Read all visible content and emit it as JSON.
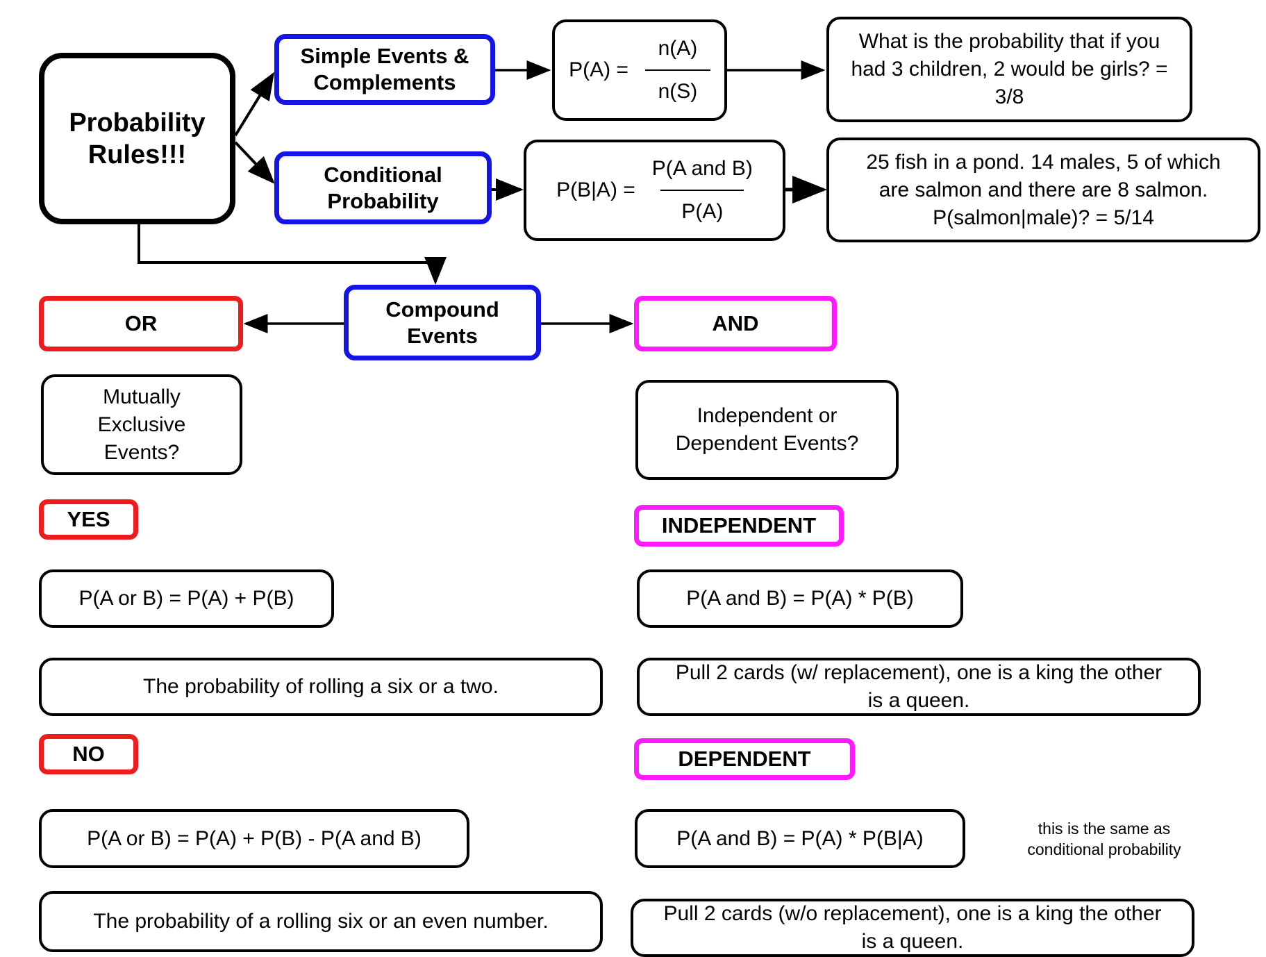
{
  "root": {
    "title_line1": "Probability",
    "title_line2": "Rules!!!"
  },
  "simple_events": {
    "label_line1": "Simple Events &",
    "label_line2": "Complements",
    "formula": {
      "lhs": "P(A) =",
      "numerator": "n(A)",
      "denominator": "n(S)"
    },
    "example": "What is the probability that if you had 3 children, 2 would be girls? = 3/8"
  },
  "conditional": {
    "label_line1": "Conditional",
    "label_line2": "Probability",
    "formula": {
      "lhs": "P(B|A) =",
      "numerator": "P(A and B)",
      "denominator": "P(A)"
    },
    "example": "25 fish in a pond. 14 males, 5 of which are salmon and there are 8 salmon. P(salmon|male)? = 5/14"
  },
  "compound": {
    "label_line1": "Compound",
    "label_line2": "Events",
    "or_branch": {
      "label": "OR",
      "question": "Mutually Exclusive Events?",
      "yes": {
        "label": "YES",
        "formula": "P(A or B) = P(A) + P(B)",
        "example": "The probability of rolling a six or a two."
      },
      "no": {
        "label": "NO",
        "formula": "P(A or B) = P(A) + P(B) - P(A and B)",
        "example": "The probability of a rolling six or an even number."
      }
    },
    "and_branch": {
      "label": "AND",
      "question": "Independent or Dependent Events?",
      "independent": {
        "label": "INDEPENDENT",
        "formula": "P(A and B) = P(A) * P(B)",
        "example": "Pull 2 cards (w/ replacement), one is a king the other is a queen."
      },
      "dependent": {
        "label": "DEPENDENT",
        "formula": "P(A and B) = P(A) * P(B|A)",
        "note": "this is the same as conditional probability",
        "example": "Pull 2 cards (w/o replacement), one is a king the other is a queen."
      }
    }
  },
  "colors": {
    "blue": "#1414e6",
    "red": "#ee1c1c",
    "magenta": "#ff1aff",
    "black": "#000000"
  }
}
